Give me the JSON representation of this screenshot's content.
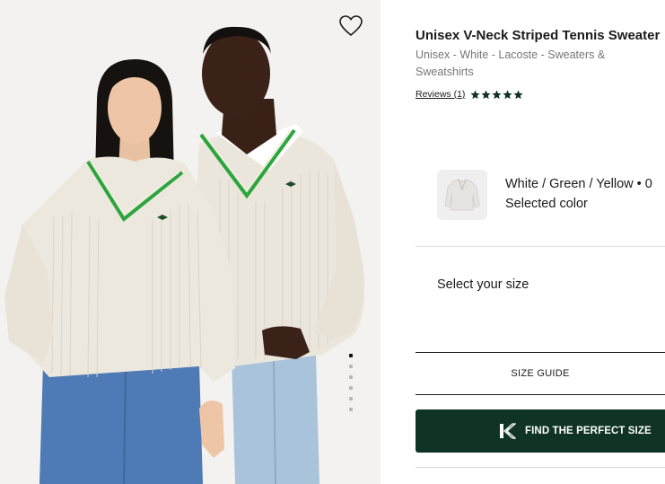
{
  "product": {
    "title": "Unisex V-Neck Striped Tennis Sweater",
    "breadcrumb": "Unisex - White - Lacoste - Sweaters & Sweatshirts",
    "reviews_label": "Reviews (1)",
    "rating": 5,
    "rating_max": 5
  },
  "color": {
    "name": "White / Green / Yellow • 0",
    "selected_label": "Selected color"
  },
  "size": {
    "select_label": "Select your size",
    "guide_label": "SIZE GUIDE",
    "fit_button_label": "FIND THE PERFECT SIZE"
  },
  "gallery": {
    "image_count": 6,
    "active_index": 0
  },
  "colors": {
    "button_bg": "#0f3325",
    "gallery_bg": "#f2f2f2",
    "accent_green": "#29a83d"
  },
  "icons": {
    "wishlist": "heart-outline-icon",
    "rating": "star-icon",
    "fit": "lacoste-k-icon"
  }
}
